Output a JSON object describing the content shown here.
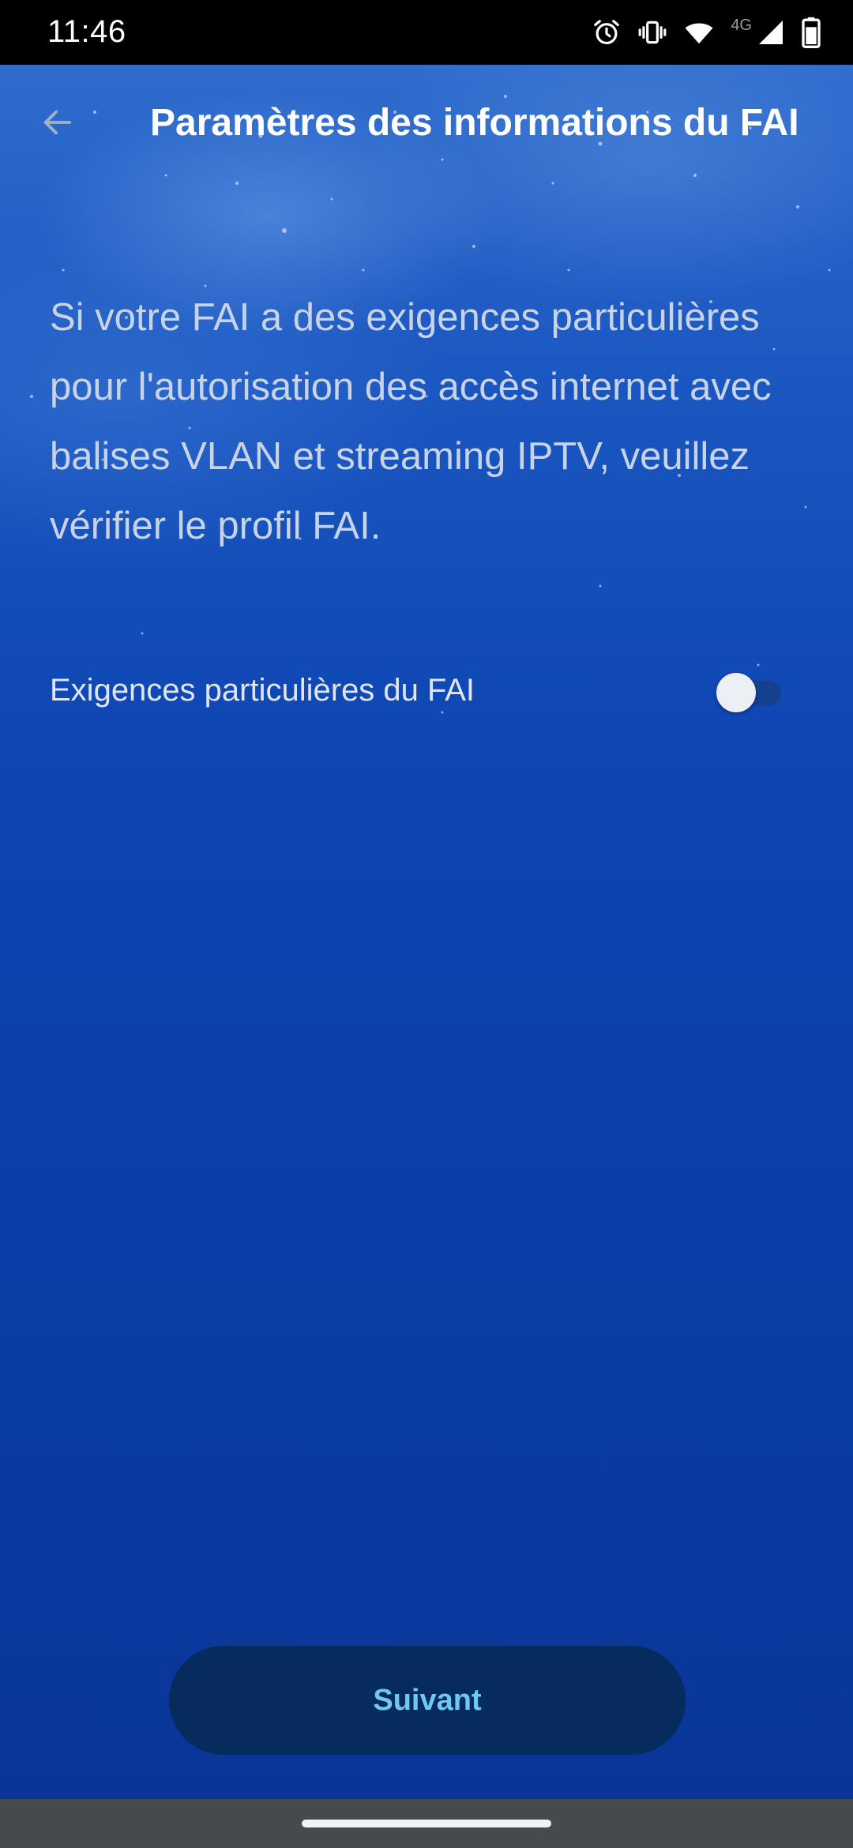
{
  "status_bar": {
    "time": "11:46",
    "network_label": "4G",
    "icons": [
      "alarm-icon",
      "vibrate-icon",
      "wifi-icon",
      "signal-icon",
      "battery-icon"
    ]
  },
  "app_bar": {
    "back_icon": "arrow-back-icon",
    "title": "Paramètres des informations du FAI"
  },
  "content": {
    "description": "Si votre FAI a des exigences particulières pour l'autorisation des accès internet avec balises VLAN et streaming IPTV, veuillez vérifier le profil FAI.",
    "toggle": {
      "label": "Exigences particulières du FAI",
      "on": false
    }
  },
  "next_button": {
    "label": "Suivant"
  },
  "colors": {
    "background": "#0b3ea6",
    "button_bg": "#052c5c",
    "button_text": "#6fc7f2",
    "title_text": "#ffffff"
  }
}
